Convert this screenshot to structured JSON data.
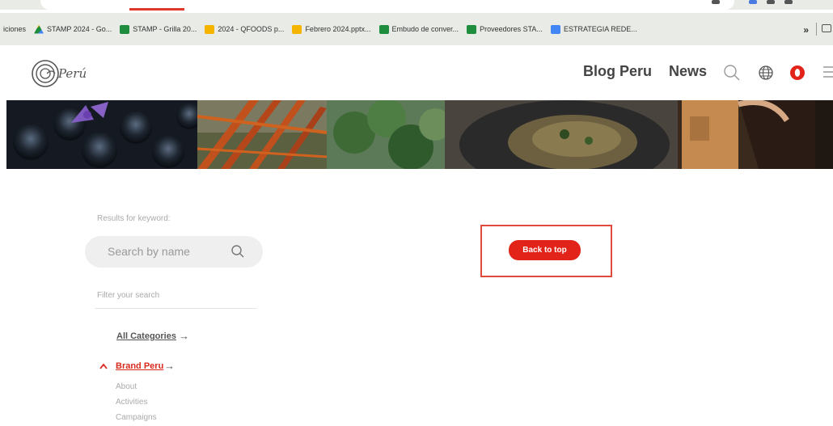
{
  "browser": {
    "bookmarks": [
      {
        "label": "iciones",
        "icon": "none"
      },
      {
        "label": "STAMP 2024 - Go...",
        "icon": "google-drive-icon"
      },
      {
        "label": "STAMP - Grilla 20...",
        "icon": "google-sheets-icon"
      },
      {
        "label": "2024 - QFOODS p...",
        "icon": "google-slides-icon"
      },
      {
        "label": "Febrero 2024.pptx...",
        "icon": "google-slides-icon"
      },
      {
        "label": "Embudo de conver...",
        "icon": "google-sheets-icon"
      },
      {
        "label": "Proveedores STA...",
        "icon": "google-sheets-icon"
      },
      {
        "label": "ESTRATEGIA REDE...",
        "icon": "google-docs-icon"
      }
    ],
    "more_label": "»"
  },
  "header": {
    "logo_text": "Perú",
    "nav": {
      "blog": "Blog Peru",
      "news": "News"
    },
    "accent_color": "#e2231a"
  },
  "sidebar": {
    "results_label": "Results for keyword:",
    "search_placeholder": "Search by name",
    "filter_label": "Filter your search",
    "all_categories": "All Categories",
    "arrow": "→",
    "active_category": "Brand Peru",
    "sub_items": [
      "About",
      "Activities",
      "Campaigns"
    ]
  },
  "main": {
    "back_to_top": "Back to top"
  }
}
